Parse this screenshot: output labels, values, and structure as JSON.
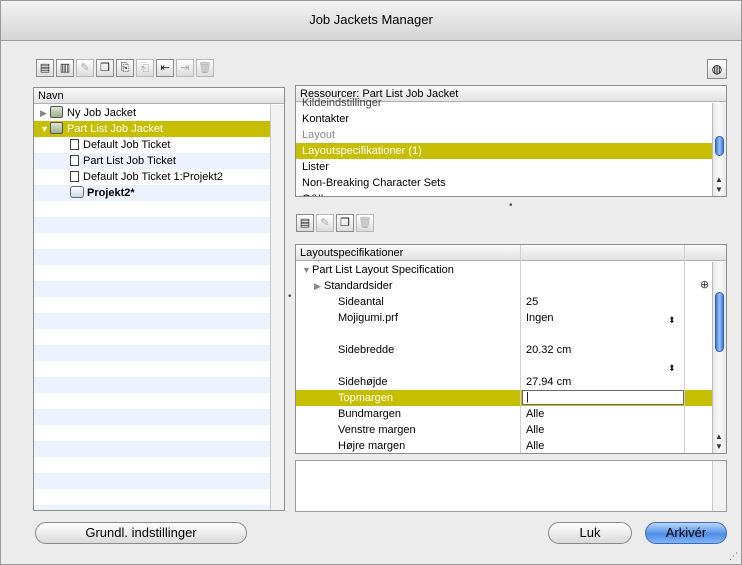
{
  "window": {
    "title": "Job Jackets Manager"
  },
  "toolbar_left": [
    {
      "icon": "new-jacket-icon",
      "glyph": "▤"
    },
    {
      "icon": "new-ticket-icon",
      "glyph": "▥"
    },
    {
      "icon": "edit-icon",
      "glyph": "✎",
      "disabled": true
    },
    {
      "icon": "duplicate-icon",
      "glyph": "❐"
    },
    {
      "icon": "link-icon",
      "glyph": "⎘"
    },
    {
      "icon": "unlink-icon",
      "glyph": "⎗",
      "disabled": true
    },
    {
      "icon": "import-icon",
      "glyph": "⇤"
    },
    {
      "icon": "export-icon",
      "glyph": "⇥",
      "disabled": true
    },
    {
      "icon": "delete-icon",
      "glyph": "🗑",
      "disabled": true
    }
  ],
  "tree": {
    "header": "Navn",
    "items": [
      {
        "label": "Ny Job Jacket",
        "level": 0,
        "type": "jacket",
        "expand": "closed"
      },
      {
        "label": "Part List Job Jacket",
        "level": 0,
        "type": "jacket",
        "expand": "open",
        "selected": true
      },
      {
        "label": "Default Job Ticket",
        "level": 1,
        "type": "doc"
      },
      {
        "label": "Part List Job Ticket",
        "level": 1,
        "type": "doc"
      },
      {
        "label": "Default Job Ticket 1:Projekt2",
        "level": 1,
        "type": "doc"
      },
      {
        "label": "Projekt2*",
        "level": 1,
        "type": "project",
        "bold": true
      }
    ]
  },
  "resources": {
    "header": "Ressourcer: Part List Job Jacket",
    "cut_item": "Kildeindstillinger",
    "items": [
      {
        "label": "Kontakter"
      },
      {
        "label": "Layout",
        "dim": true
      },
      {
        "label": "Layoutspecifikationer (1)",
        "selected": true
      },
      {
        "label": "Lister"
      },
      {
        "label": "Non-Breaking Character Sets"
      },
      {
        "label": "O&I'er"
      }
    ]
  },
  "toolbar_mid": [
    {
      "icon": "new-spec-icon",
      "glyph": "▤"
    },
    {
      "icon": "edit-spec-icon",
      "glyph": "✎",
      "disabled": true
    },
    {
      "icon": "duplicate-spec-icon",
      "glyph": "❐"
    },
    {
      "icon": "delete-spec-icon",
      "glyph": "🗑",
      "disabled": true
    }
  ],
  "specs": {
    "header": "Layoutspecifikationer",
    "rows": [
      {
        "label": "Part List Layout Specification",
        "value": "",
        "level": 0,
        "expand": "open"
      },
      {
        "label": "Standardsider",
        "value": "",
        "level": 1,
        "expand": "closed"
      },
      {
        "label": "Sideantal",
        "value": "25",
        "level": 2
      },
      {
        "label": "Mojigumi.prf",
        "value": "Ingen",
        "level": 2,
        "popup": true
      },
      {
        "label": "",
        "value": "",
        "level": 2
      },
      {
        "label": "Sidebredde",
        "value": "20.32 cm",
        "level": 2
      },
      {
        "label": "",
        "value": "",
        "level": 2,
        "popup": true
      },
      {
        "label": "Sidehøjde",
        "value": "27.94 cm",
        "level": 2
      },
      {
        "label": "Topmargen",
        "value": "",
        "level": 2,
        "selected": true,
        "editing": true
      },
      {
        "label": "Bundmargen",
        "value": "Alle",
        "level": 2
      },
      {
        "label": "Venstre margen",
        "value": "Alle",
        "level": 2
      },
      {
        "label": "Højre margen",
        "value": "Alle",
        "level": 2
      }
    ]
  },
  "buttons": {
    "defaults": "Grundl. indstillinger",
    "close": "Luk",
    "archive": "Arkivér"
  },
  "colors": {
    "selection": "#c8be00",
    "stripe": "#edf3fe",
    "default_button": "#4f8ee8"
  }
}
